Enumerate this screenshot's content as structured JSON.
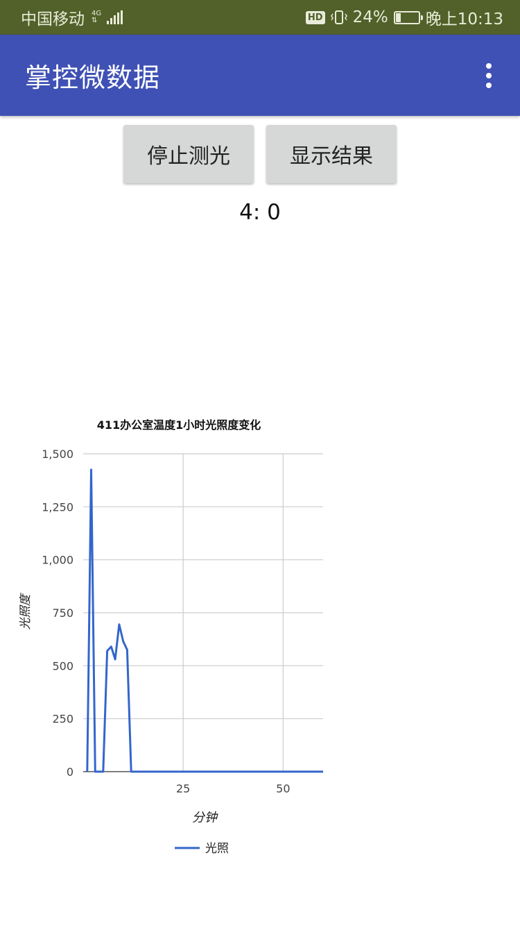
{
  "status_bar": {
    "carrier": "中国移动",
    "network_type": "4G",
    "hd": "HD",
    "battery_percent": "24%",
    "battery_level": 0.24,
    "time": "晚上10:13"
  },
  "app_bar": {
    "title": "掌控微数据"
  },
  "buttons": {
    "stop_label": "停止测光",
    "show_label": "显示结果"
  },
  "readout": "4: 0",
  "chart_data": {
    "type": "line",
    "title": "411办公室温度1小时光照度变化",
    "xlabel": "分钟",
    "ylabel": "光照度",
    "xlim": [
      0,
      60
    ],
    "ylim": [
      0,
      1500
    ],
    "x_ticks": [
      25,
      50
    ],
    "y_ticks": [
      0,
      250,
      500,
      750,
      1000,
      1250,
      1500
    ],
    "y_tick_labels": [
      "0",
      "250",
      "500",
      "750",
      "1,000",
      "1,250",
      "1,500"
    ],
    "grid": true,
    "legend_position": "bottom",
    "color": "#3366cc",
    "series": [
      {
        "name": "光照",
        "x": [
          1,
          2,
          3,
          4,
          5,
          6,
          7,
          8,
          9,
          10,
          11,
          12,
          13,
          14,
          15,
          16,
          17,
          18,
          19,
          20,
          21,
          22,
          23,
          24,
          25,
          26,
          27,
          28,
          29,
          30,
          31,
          32,
          33,
          34,
          35,
          36,
          37,
          38,
          39,
          40,
          41,
          42,
          43,
          44,
          45,
          46,
          47,
          48,
          49,
          50,
          51,
          52,
          53,
          54,
          55,
          56,
          57,
          58,
          59,
          60
        ],
        "y": [
          0,
          1425,
          0,
          0,
          0,
          570,
          590,
          530,
          695,
          615,
          575,
          0,
          0,
          0,
          0,
          0,
          0,
          0,
          0,
          0,
          0,
          0,
          0,
          0,
          0,
          0,
          0,
          0,
          0,
          0,
          0,
          0,
          0,
          0,
          0,
          0,
          0,
          0,
          0,
          0,
          0,
          0,
          0,
          0,
          0,
          0,
          0,
          0,
          0,
          0,
          0,
          0,
          0,
          0,
          0,
          0,
          0,
          0,
          0,
          0
        ]
      }
    ]
  }
}
